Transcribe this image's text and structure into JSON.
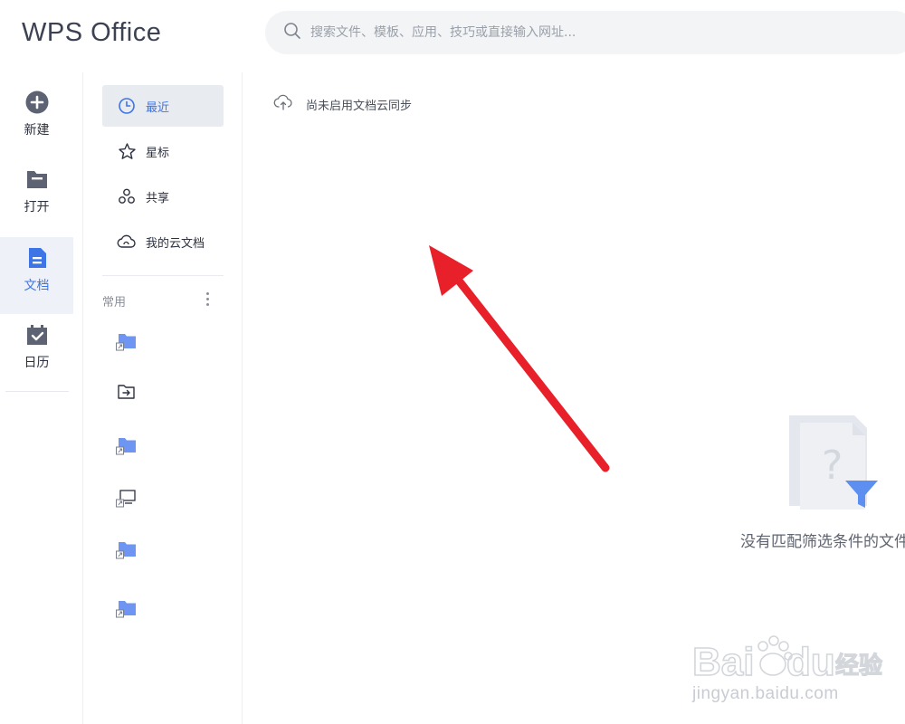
{
  "app": {
    "logo_text": "WPS Office"
  },
  "search": {
    "placeholder": "搜索文件、模板、应用、技巧或直接输入网址..."
  },
  "rail": {
    "items": [
      {
        "label": "新建",
        "icon": "plus-circle-icon"
      },
      {
        "label": "打开",
        "icon": "folder-icon"
      },
      {
        "label": "文档",
        "icon": "document-icon",
        "active": true
      },
      {
        "label": "日历",
        "icon": "calendar-check-icon"
      }
    ]
  },
  "nav": {
    "items": [
      {
        "label": "最近",
        "icon": "clock-icon",
        "active": true
      },
      {
        "label": "星标",
        "icon": "star-icon"
      },
      {
        "label": "共享",
        "icon": "share-icon"
      },
      {
        "label": "我的云文档",
        "icon": "cloud-icon"
      }
    ],
    "common_title": "常用",
    "common_items": [
      {
        "icon": "folder-shortcut-icon"
      },
      {
        "icon": "import-icon"
      },
      {
        "icon": "folder-shortcut-icon"
      },
      {
        "icon": "desktop-shortcut-icon"
      },
      {
        "icon": "folder-shortcut-icon"
      },
      {
        "icon": "folder-shortcut-icon"
      }
    ]
  },
  "main": {
    "sync_text": "尚未启用文档云同步",
    "empty_text": "没有匹配筛选条件的文件"
  },
  "watermark": {
    "text": "jingyan.baidu.com",
    "brand": "Bai du 经验"
  },
  "colors": {
    "accent": "#3d74e6",
    "icon_dark": "#5d6373",
    "arrow": "#e8202a",
    "folder_blue": "#6e95f2"
  }
}
